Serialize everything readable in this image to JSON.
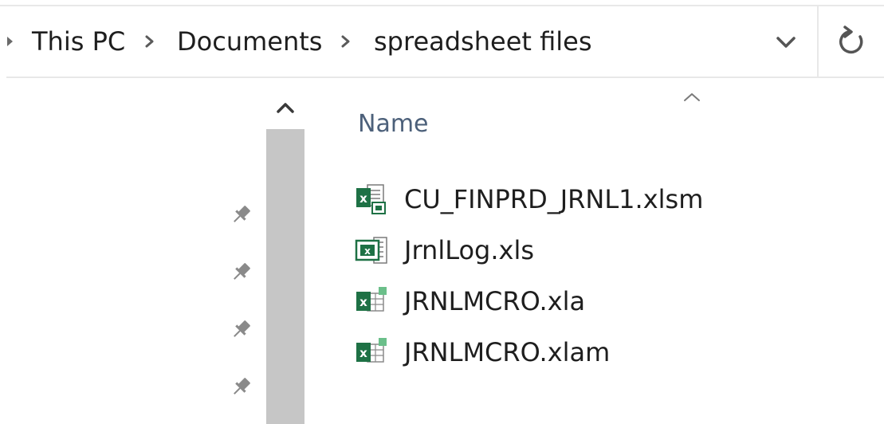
{
  "address_bar": {
    "breadcrumbs": [
      "This PC",
      "Documents",
      "spreadsheet files"
    ],
    "dropdown_icon": "chevron-down-icon",
    "refresh_icon": "refresh-icon"
  },
  "nav_pane": {
    "pins": [
      "pin-icon",
      "pin-icon",
      "pin-icon",
      "pin-icon"
    ],
    "scroll_up_icon": "chevron-up-icon"
  },
  "file_list": {
    "sort_indicator_icon": "sort-ascending-caret-icon",
    "column_header": "Name",
    "files": [
      {
        "name": "CU_FINPRD_JRNL1.xlsm",
        "icon": "excel-macro-workbook-icon"
      },
      {
        "name": "JrnlLog.xls",
        "icon": "excel-97-workbook-icon"
      },
      {
        "name": "JRNLMCRO.xla",
        "icon": "excel-addin-icon"
      },
      {
        "name": "JRNLMCRO.xlam",
        "icon": "excel-addin-icon"
      }
    ]
  },
  "colors": {
    "excel_green": "#1e7145",
    "header_text": "#4c607a",
    "scrollbar_thumb": "#c6c6c6"
  }
}
